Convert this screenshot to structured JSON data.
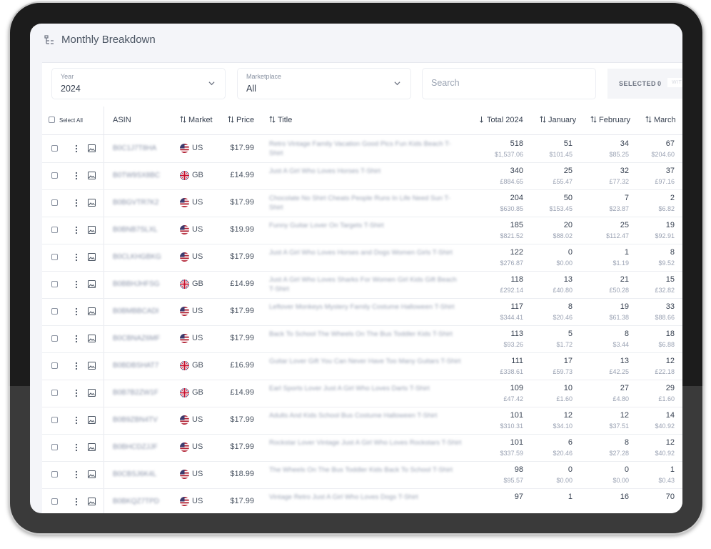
{
  "page": {
    "title": "Monthly Breakdown"
  },
  "filters": {
    "year": {
      "label": "Year",
      "value": "2024"
    },
    "marketplace": {
      "label": "Marketplace",
      "value": "All"
    },
    "search": {
      "placeholder": "Search"
    },
    "selected": {
      "label": "SELECTED",
      "count": "0",
      "with_label": "WITH"
    }
  },
  "table": {
    "headers": {
      "select_all": "Select All",
      "asin": "ASIN",
      "market": "Market",
      "price": "Price",
      "title": "Title",
      "total": "Total 2024",
      "january": "January",
      "february": "February",
      "march": "March"
    },
    "rows": [
      {
        "asin": "B0C1J7T8HA",
        "flag": "us",
        "market": "US",
        "price": "$17.99",
        "title": "Retro Vintage Family Vacation Good Pics Fun Kids Beach T-Shirt",
        "total": "518",
        "total_money": "$1,537.06",
        "jan": "51",
        "jan_money": "$101.45",
        "feb": "34",
        "feb_money": "$85.25",
        "mar": "67",
        "mar_money": "$204.60"
      },
      {
        "asin": "B0TW9SX8BC",
        "flag": "gb",
        "market": "GB",
        "price": "£14.99",
        "title": "Just A Girl Who Loves Horses T-Shirt",
        "total": "340",
        "total_money": "£884.65",
        "jan": "25",
        "jan_money": "£55.47",
        "feb": "32",
        "feb_money": "£77.32",
        "mar": "37",
        "mar_money": "£97.16"
      },
      {
        "asin": "B0BGVTR7K2",
        "flag": "us",
        "market": "US",
        "price": "$17.99",
        "title": "Chocolate No Shirt Cheats People Runs In Life Need Sun T-Shirt",
        "total": "204",
        "total_money": "$630.85",
        "jan": "50",
        "jan_money": "$153.45",
        "feb": "7",
        "feb_money": "$23.87",
        "mar": "2",
        "mar_money": "$6.82"
      },
      {
        "asin": "B0BNB7SLXL",
        "flag": "us",
        "market": "US",
        "price": "$19.99",
        "title": "Funny Guitar Lover On Targets T-Shirt",
        "total": "185",
        "total_money": "$821.52",
        "jan": "20",
        "jan_money": "$88.02",
        "feb": "25",
        "feb_money": "$112.47",
        "mar": "19",
        "mar_money": "$92.91"
      },
      {
        "asin": "B0CLKHGBKG",
        "flag": "us",
        "market": "US",
        "price": "$17.99",
        "title": "Just A Girl Who Loves Horses and Dogs Women Girls T-Shirt",
        "total": "122",
        "total_money": "$276.87",
        "jan": "0",
        "jan_money": "$0.00",
        "feb": "1",
        "feb_money": "$1.19",
        "mar": "8",
        "mar_money": "$9.52"
      },
      {
        "asin": "B0BBHJHFSG",
        "flag": "gb",
        "market": "GB",
        "price": "£14.99",
        "title": "Just A Girl Who Loves Sharks For Women Girl Kids Gift Beach T-Shirt",
        "total": "118",
        "total_money": "£292.14",
        "jan": "13",
        "jan_money": "£40.80",
        "feb": "21",
        "feb_money": "£50.28",
        "mar": "15",
        "mar_money": "£32.82"
      },
      {
        "asin": "B0BMBBCADI",
        "flag": "us",
        "market": "US",
        "price": "$17.99",
        "title": "Leftover Monkeys Mystery Family Costume Halloween T-Shirt",
        "total": "117",
        "total_money": "$344.41",
        "jan": "8",
        "jan_money": "$20.46",
        "feb": "19",
        "feb_money": "$61.38",
        "mar": "33",
        "mar_money": "$88.66"
      },
      {
        "asin": "B0CBNAZ6MF",
        "flag": "us",
        "market": "US",
        "price": "$17.99",
        "title": "Back To School The Wheels On The Bus Toddler Kids T-Shirt",
        "total": "113",
        "total_money": "$93.26",
        "jan": "5",
        "jan_money": "$1.72",
        "feb": "8",
        "feb_money": "$3.44",
        "mar": "18",
        "mar_money": "$6.88"
      },
      {
        "asin": "B0BDBSHAT7",
        "flag": "gb",
        "market": "GB",
        "price": "£16.99",
        "title": "Guitar Lover Gift You Can Never Have Too Many Guitars T-Shirt",
        "total": "111",
        "total_money": "£338.61",
        "jan": "17",
        "jan_money": "£59.73",
        "feb": "13",
        "feb_money": "£42.25",
        "mar": "12",
        "mar_money": "£22.18"
      },
      {
        "asin": "B0B7B2ZW1F",
        "flag": "gb",
        "market": "GB",
        "price": "£14.99",
        "title": "Earl Sports Lover Just A Girl Who Loves Darts T-Shirt",
        "total": "109",
        "total_money": "£47.42",
        "jan": "10",
        "jan_money": "£1.60",
        "feb": "27",
        "feb_money": "£4.80",
        "mar": "29",
        "mar_money": "£1.60"
      },
      {
        "asin": "B0B9ZBN4TV",
        "flag": "us",
        "market": "US",
        "price": "$17.99",
        "title": "Adults And Kids School Bus Costume Halloween T-Shirt",
        "total": "101",
        "total_money": "$310.31",
        "jan": "12",
        "jan_money": "$34.10",
        "feb": "12",
        "feb_money": "$37.51",
        "mar": "14",
        "mar_money": "$40.92"
      },
      {
        "asin": "B0BHCDZJJF",
        "flag": "us",
        "market": "US",
        "price": "$17.99",
        "title": "Rockstar Lover Vintage Just A Girl Who Loves Rockstars T-Shirt",
        "total": "101",
        "total_money": "$337.59",
        "jan": "6",
        "jan_money": "$20.46",
        "feb": "8",
        "feb_money": "$27.28",
        "mar": "12",
        "mar_money": "$40.92"
      },
      {
        "asin": "B0CBSJ6K4L",
        "flag": "us",
        "market": "US",
        "price": "$18.99",
        "title": "The Wheels On The Bus Toddler Kids Back To School T-Shirt",
        "total": "98",
        "total_money": "$95.57",
        "jan": "0",
        "jan_money": "$0.00",
        "feb": "0",
        "feb_money": "$0.00",
        "mar": "1",
        "mar_money": "$0.43"
      },
      {
        "asin": "B0BKQZ7TPD",
        "flag": "us",
        "market": "US",
        "price": "$17.99",
        "title": "Vintage Retro Just A Girl Who Loves Dogs T-Shirt",
        "total": "97",
        "total_money": "",
        "jan": "1",
        "jan_money": "",
        "feb": "16",
        "feb_money": "",
        "mar": "70",
        "mar_money": ""
      }
    ]
  }
}
